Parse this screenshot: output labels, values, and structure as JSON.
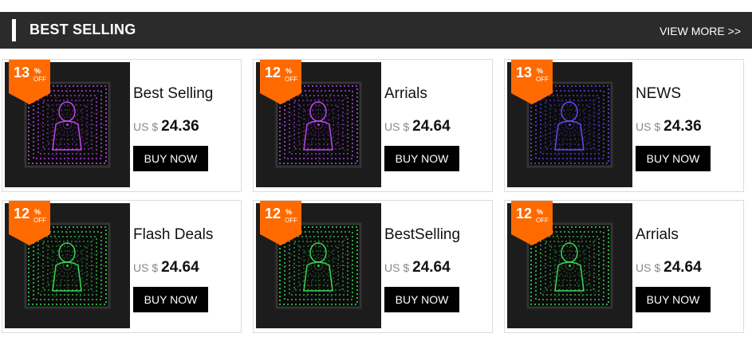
{
  "section": {
    "title": "BEST SELLING",
    "view_more": "VIEW MORE >>"
  },
  "colors": {
    "header_bg": "#2b2b2b",
    "badge": "#ff6a00",
    "button": "#000000"
  },
  "products": [
    {
      "name": "Best Selling",
      "currency": "US $",
      "price": "24.36",
      "discount": "13",
      "pct": "%",
      "off": "OFF",
      "button": "BUY NOW",
      "light": "#c84bff",
      "figure": "girl-icon"
    },
    {
      "name": "Arrials",
      "currency": "US $",
      "price": "24.64",
      "discount": "12",
      "pct": "%",
      "off": "OFF",
      "button": "BUY NOW",
      "light": "#c04cff",
      "figure": "ballerina-icon"
    },
    {
      "name": "NEWS",
      "currency": "US $",
      "price": "24.36",
      "discount": "13",
      "pct": "%",
      "off": "OFF",
      "button": "BUY NOW",
      "light": "#6b4cff",
      "figure": "cat-icon"
    },
    {
      "name": "Flash Deals",
      "currency": "US $",
      "price": "24.64",
      "discount": "12",
      "pct": "%",
      "off": "OFF",
      "button": "BUY NOW",
      "light": "#3fe05a",
      "figure": "face-icon"
    },
    {
      "name": "BestSelling",
      "currency": "US $",
      "price": "24.64",
      "discount": "12",
      "pct": "%",
      "off": "OFF",
      "button": "BUY NOW",
      "light": "#3fe05a",
      "figure": "rider-icon"
    },
    {
      "name": "Arrials",
      "currency": "US $",
      "price": "24.64",
      "discount": "12",
      "pct": "%",
      "off": "OFF",
      "button": "BUY NOW",
      "light": "#3fe05a",
      "figure": "bull-icon"
    }
  ]
}
